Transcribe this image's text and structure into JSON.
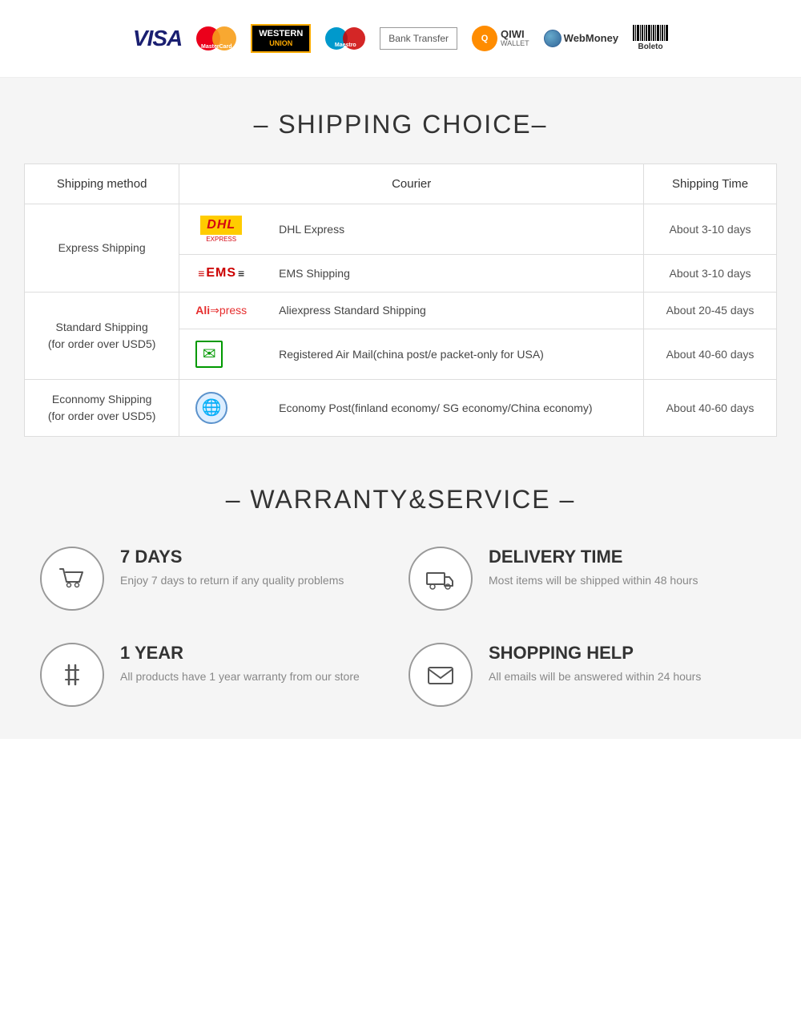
{
  "payment": {
    "methods": [
      "VISA",
      "MasterCard",
      "Western Union",
      "Maestro",
      "Bank Transfer",
      "QIWI WALLET",
      "WebMoney",
      "Boleto"
    ]
  },
  "shipping": {
    "title": "– SHIPPING CHOICE–",
    "table": {
      "headers": [
        "Shipping method",
        "Courier",
        "Shipping Time"
      ],
      "rows": [
        {
          "method": "Express Shipping",
          "courier_name": "DHL Express",
          "courier_logo": "DHL",
          "time": "About 3-10 days"
        },
        {
          "method": "Express Shipping",
          "courier_name": "EMS Shipping",
          "courier_logo": "EMS",
          "time": "About 3-10 days"
        },
        {
          "method": "Standard Shipping\n(for order over USD5)",
          "courier_name": "Aliexpress Standard Shipping",
          "courier_logo": "ALIEXPRESS",
          "time": "About 20-45 days"
        },
        {
          "method": "Standard Shipping\n(for order over USD5)",
          "courier_name": "Registered Air Mail(china post/e packet-only for USA)",
          "courier_logo": "CHINAPOST",
          "time": "About 40-60 days"
        },
        {
          "method": "Econnomy Shipping\n(for order over USD5)",
          "courier_name": "Economy Post(finland economy/ SG economy/China economy)",
          "courier_logo": "UN",
          "time": "About 40-60 days"
        }
      ]
    }
  },
  "warranty": {
    "title": "– WARRANTY&SERVICE –",
    "items": [
      {
        "id": "7days",
        "title": "7 DAYS",
        "desc": "Enjoy 7 days to return if any quality problems",
        "icon": "cart"
      },
      {
        "id": "delivery",
        "title": "DELIVERY TIME",
        "desc": "Most items will be shipped within 48 hours",
        "icon": "truck"
      },
      {
        "id": "1year",
        "title": "1 YEAR",
        "desc": "All products have 1 year warranty from our store",
        "icon": "tools"
      },
      {
        "id": "shopping-help",
        "title": "SHOPPING HELP",
        "desc": "All emails will be answered within 24 hours",
        "icon": "mail"
      }
    ]
  }
}
